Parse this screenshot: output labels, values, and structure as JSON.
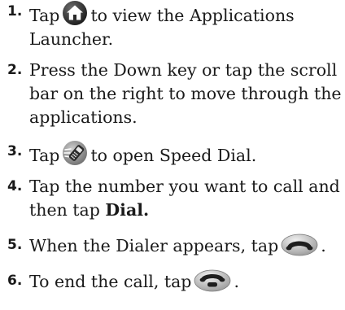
{
  "steps": [
    {
      "number": "1.",
      "before": "Tap",
      "icon": "home-icon",
      "after": "to view the Applications Launcher."
    },
    {
      "number": "2.",
      "text": "Press the Down key or tap the scroll bar on the right to move through the applications."
    },
    {
      "number": "3.",
      "before": "Tap",
      "icon": "speed-dial-icon",
      "after": "to open Speed Dial."
    },
    {
      "number": "4.",
      "text": "Tap the number you want to call and then tap",
      "bold": "Dial."
    },
    {
      "number": "5.",
      "before": "When the Dialer appears, tap",
      "icon": "call-icon",
      "after": "."
    },
    {
      "number": "6.",
      "before": "To end the call, tap",
      "icon": "end-call-icon",
      "after": "."
    }
  ],
  "colors": {
    "text": "#1a1a1a",
    "icon_dark": "#2b2b2b",
    "icon_mid": "#8a8a8a",
    "icon_light": "#d9d9d9"
  }
}
